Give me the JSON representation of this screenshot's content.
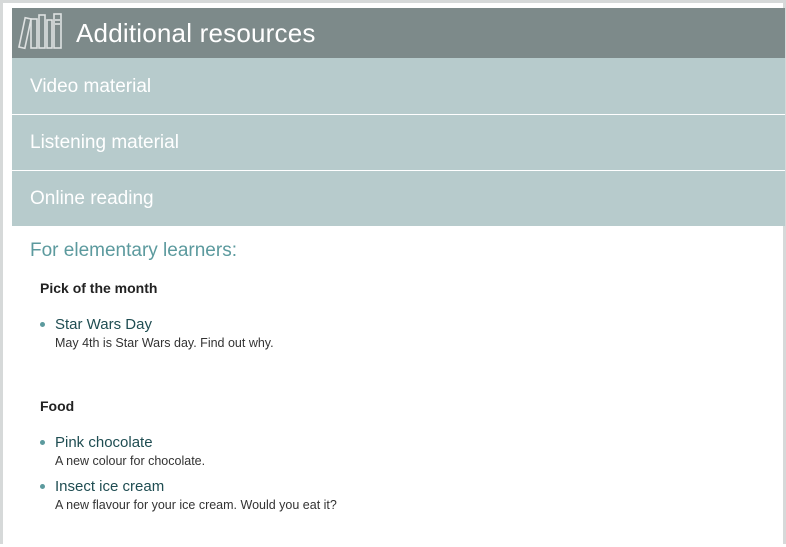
{
  "header": {
    "title": "Additional resources",
    "icon": "books-icon",
    "background": "#7d8a8a"
  },
  "accordion": [
    {
      "label": "Video material"
    },
    {
      "label": "Listening material"
    },
    {
      "label": "Online reading"
    }
  ],
  "online_reading": {
    "level_heading": "For elementary learners:",
    "groups": [
      {
        "title": "Pick of the month",
        "items": [
          {
            "link": "Star Wars Day",
            "description": "May 4th is Star Wars day. Find out why."
          }
        ]
      },
      {
        "title": "Food",
        "items": [
          {
            "link": "Pink chocolate",
            "description": "A new colour for chocolate."
          },
          {
            "link": "Insect ice cream",
            "description": "A new flavour for your ice cream. Would you eat it?"
          }
        ]
      }
    ]
  },
  "colors": {
    "accordion": "#b7cbcc",
    "accent": "#5c9a9e",
    "link": "#1f4d52"
  }
}
